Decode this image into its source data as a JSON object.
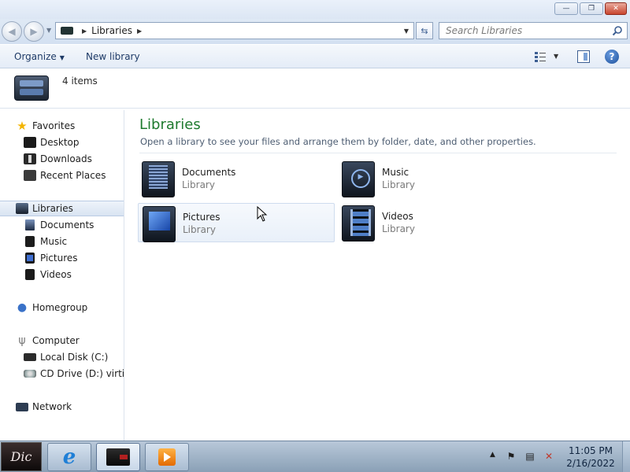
{
  "window": {
    "minimize_label": "—",
    "restore_label": "❐",
    "close_label": "✕"
  },
  "navbar": {
    "back_icon": "◀",
    "forward_icon": "▶",
    "address_label": "Libraries",
    "search_placeholder": "Search Libraries"
  },
  "toolbar": {
    "organize_label": "Organize",
    "new_library_label": "New library",
    "help_label": "?"
  },
  "details": {
    "item_count": "4 items"
  },
  "sidebar": {
    "favorites": "Favorites",
    "desktop": "Desktop",
    "downloads": "Downloads",
    "recent_places": "Recent Places",
    "libraries": "Libraries",
    "documents": "Documents",
    "music": "Music",
    "pictures": "Pictures",
    "videos": "Videos",
    "homegroup": "Homegroup",
    "computer": "Computer",
    "local_disk": "Local Disk (C:)",
    "cd_drive": "CD Drive (D:) virtio-w",
    "network": "Network"
  },
  "main": {
    "title": "Libraries",
    "subtitle": "Open a library to see your files and arrange them by folder, date, and other properties.",
    "libraries": [
      {
        "name": "Documents",
        "type": "Library"
      },
      {
        "name": "Music",
        "type": "Library"
      },
      {
        "name": "Pictures",
        "type": "Library"
      },
      {
        "name": "Videos",
        "type": "Library"
      }
    ]
  },
  "taskbar": {
    "start_label": "Dic",
    "ie_label": "e",
    "clock_time": "11:05 PM",
    "clock_date": "2/16/2022"
  }
}
